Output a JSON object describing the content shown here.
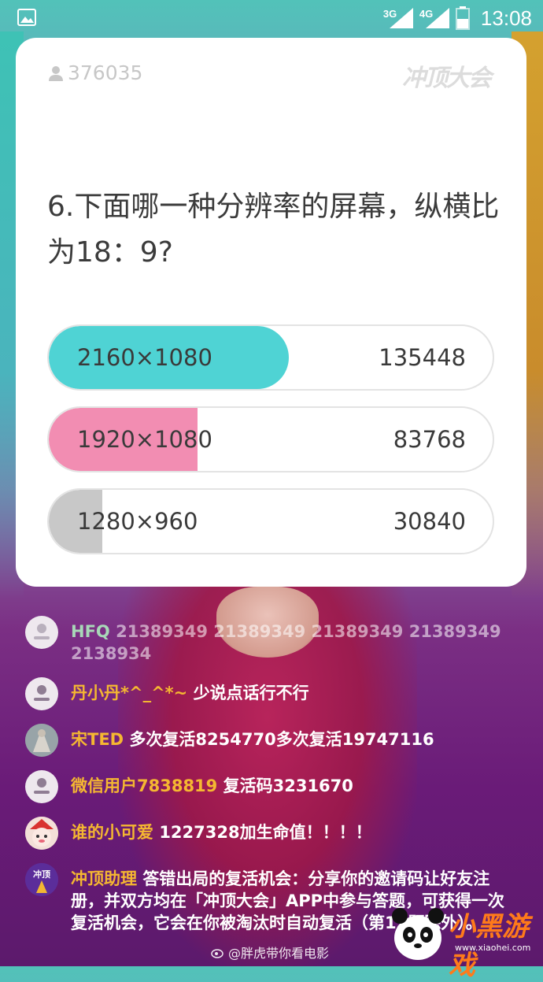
{
  "status_bar": {
    "net1": "3G",
    "net2": "4G",
    "time": "13:08"
  },
  "card": {
    "viewer_count": "376035",
    "logo": "冲顶大会",
    "question": "6.下面哪一种分辨率的屏幕，纵横比为18：9?",
    "options": [
      {
        "label": "2160×1080",
        "count": "135448",
        "fill_fraction": 0.54,
        "color": "#4fd3d4"
      },
      {
        "label": "1920×1080",
        "count": "83768",
        "fill_fraction": 0.335,
        "color": "#f28db2"
      },
      {
        "label": "1280×960",
        "count": "30840",
        "fill_fraction": 0.12,
        "color": "#c8c8c8"
      }
    ]
  },
  "chat": [
    {
      "name": "HFQ",
      "message": "21389349  21389349  21389349  21389349  2138934",
      "avatar": "person-icon"
    },
    {
      "name": "丹小丹*^_^*~",
      "message": "少说点话行不行",
      "avatar": "person-icon"
    },
    {
      "name": "宋TED",
      "message": "多次复活8254770多次复活19747116",
      "avatar": "photo-avatar"
    },
    {
      "name": "微信用户7838819",
      "message": "复活码3231670",
      "avatar": "person-icon"
    },
    {
      "name": "谁的小可爱",
      "message": "1227328加生命值！！！！",
      "avatar": "cartoon-avatar"
    },
    {
      "name": "冲顶助理",
      "message": "答错出局的复活机会：分享你的邀请码让好友注册，并双方均在「冲顶大会」APP中参与答题，可获得一次复活机会，它会在你被淘汰时自动复活（第12题除外）。",
      "avatar": "assistant-avatar"
    }
  ],
  "watermark": "@胖虎带你看电影",
  "site_logo": {
    "title": "小黑游戏",
    "url": "www.xiaohei.com"
  }
}
